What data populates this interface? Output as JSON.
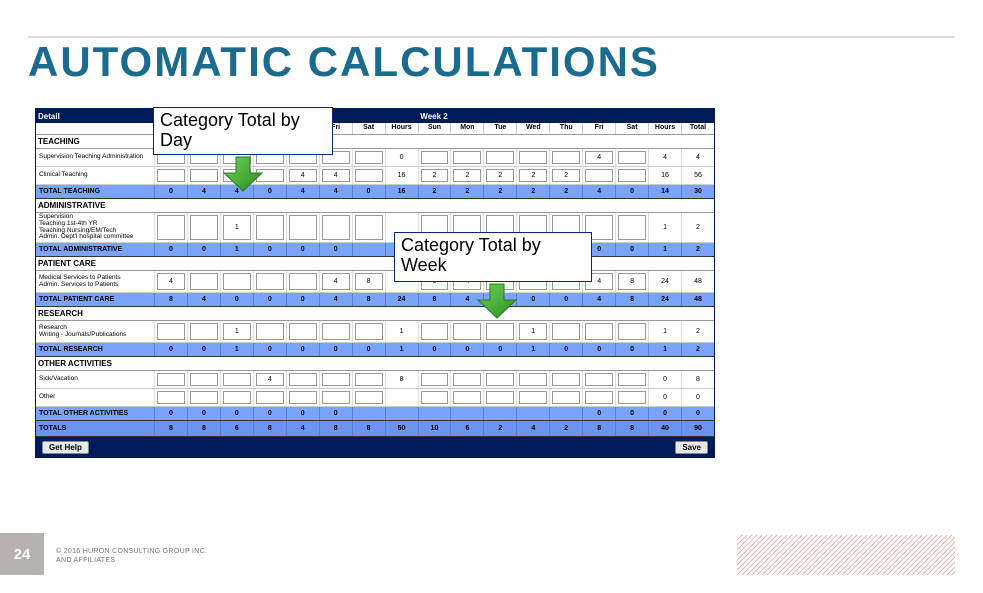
{
  "title": "AUTOMATIC CALCULATIONS",
  "callouts": {
    "day": "Category Total by Day",
    "week": "Category Total by Week"
  },
  "header": {
    "detail": "Detail",
    "week2": "Week 2"
  },
  "days": [
    "Sun",
    "Mon",
    "Tue",
    "Wed",
    "Thu",
    "Fri",
    "Sat",
    "Hours",
    "Sun",
    "Mon",
    "Tue",
    "Wed",
    "Thu",
    "Fri",
    "Sat",
    "Hours",
    "Total"
  ],
  "sections": {
    "teaching": {
      "hdr": "TEACHING",
      "row1": {
        "label": "Supervision Teaching Administration",
        "vals": [
          "",
          "",
          "",
          "",
          "",
          "",
          "",
          "0",
          "",
          "",
          "",
          "",
          "",
          "4",
          "",
          "4",
          "4"
        ]
      },
      "row2": {
        "label": "Clinical Teaching",
        "vals": [
          "",
          "",
          "4",
          "",
          "4",
          "4",
          "",
          "16",
          "2",
          "2",
          "2",
          "2",
          "2",
          "",
          "",
          "16",
          "56"
        ]
      },
      "total": {
        "label": "TOTAL TEACHING",
        "vals": [
          "0",
          "4",
          "4",
          "0",
          "4",
          "4",
          "0",
          "16",
          "2",
          "2",
          "2",
          "2",
          "2",
          "4",
          "0",
          "14",
          "30"
        ]
      }
    },
    "admin": {
      "hdr": "ADMINISTRATIVE",
      "row1": {
        "label": "Supervision\nTeaching 1st-4th YR\nTeaching Nursing/EM/Tech\nAdmin. Dept'l hospital committee",
        "vals": [
          "",
          "",
          "1",
          "",
          "",
          "",
          "",
          "",
          "",
          "",
          "",
          "",
          "",
          "",
          "",
          "1",
          "2"
        ]
      },
      "total": {
        "label": "TOTAL ADMINISTRATIVE",
        "vals": [
          "0",
          "0",
          "1",
          "0",
          "0",
          "0",
          "",
          "",
          "",
          "",
          "",
          "",
          "",
          "0",
          "0",
          "1",
          "2"
        ]
      }
    },
    "patient": {
      "hdr": "PATIENT CARE",
      "row1": {
        "label": "Medical Services to Patients\nAdmin. Services to Patients",
        "vals": [
          "4",
          "",
          "",
          "",
          "",
          "4",
          "8",
          "",
          "8",
          "4",
          "",
          "",
          "",
          "4",
          "8",
          "24",
          "48"
        ]
      },
      "total": {
        "label": "TOTAL PATIENT CARE",
        "vals": [
          "8",
          "4",
          "0",
          "0",
          "0",
          "4",
          "8",
          "24",
          "8",
          "4",
          "0",
          "0",
          "0",
          "4",
          "8",
          "24",
          "48"
        ]
      }
    },
    "research": {
      "hdr": "RESEARCH",
      "row1": {
        "label": "Research\nWriting - Journals/Publications",
        "vals": [
          "",
          "",
          "1",
          "",
          "",
          "",
          "",
          "1",
          "",
          "",
          "",
          "1",
          "",
          "",
          "",
          "1",
          "2"
        ]
      },
      "total": {
        "label": "TOTAL RESEARCH",
        "vals": [
          "0",
          "0",
          "1",
          "0",
          "0",
          "0",
          "0",
          "1",
          "0",
          "0",
          "0",
          "1",
          "0",
          "0",
          "0",
          "1",
          "2"
        ]
      }
    },
    "other": {
      "hdr": "OTHER ACTIVITIES",
      "row1": {
        "label": "Sick/Vacation",
        "vals": [
          "",
          "",
          "",
          "4",
          "",
          "",
          "",
          "8",
          "",
          "",
          "",
          "",
          "",
          "",
          "",
          "0",
          "8"
        ]
      },
      "row2": {
        "label": "Other",
        "vals": [
          "",
          "",
          "",
          "",
          "",
          "",
          "",
          "",
          "",
          "",
          "",
          "",
          "",
          "",
          "",
          "0",
          "0"
        ]
      },
      "total": {
        "label": "TOTAL OTHER ACTIVITIES",
        "vals": [
          "0",
          "0",
          "0",
          "0",
          "0",
          "0",
          "",
          "",
          "",
          "",
          "",
          "",
          "",
          "0",
          "0",
          "0",
          "0"
        ]
      }
    },
    "totals": {
      "label": "TOTALS",
      "vals": [
        "8",
        "8",
        "6",
        "8",
        "4",
        "8",
        "8",
        "50",
        "10",
        "6",
        "2",
        "4",
        "2",
        "8",
        "8",
        "40",
        "90"
      ]
    }
  },
  "buttons": {
    "help": "Get Help",
    "save": "Save"
  },
  "footer": {
    "page": "24",
    "credit1": "© 2016 HURON CONSULTING GROUP INC.",
    "credit2": "AND AFFILIATES"
  }
}
